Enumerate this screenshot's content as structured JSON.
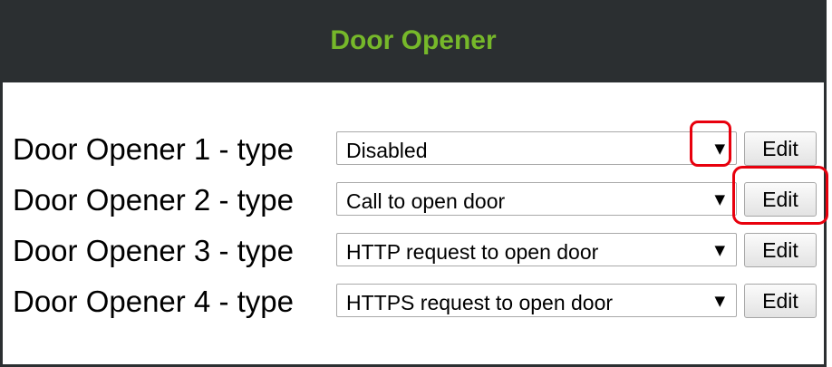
{
  "header": {
    "title": "Door Opener"
  },
  "rows": [
    {
      "label": "Door Opener 1 - type",
      "selected": "Disabled",
      "arrow": "▼",
      "edit_label": "Edit"
    },
    {
      "label": "Door Opener 2 - type",
      "selected": "Call to open door",
      "arrow": "▼",
      "edit_label": "Edit"
    },
    {
      "label": "Door Opener 3 - type",
      "selected": "HTTP request to open door",
      "arrow": "▼",
      "edit_label": "Edit"
    },
    {
      "label": "Door Opener 4 - type",
      "selected": "HTTPS request to open door",
      "arrow": "▼",
      "edit_label": "Edit"
    }
  ],
  "colors": {
    "header_bg": "#2b2f31",
    "header_text": "#76b82a",
    "highlight": "#e8000d"
  }
}
